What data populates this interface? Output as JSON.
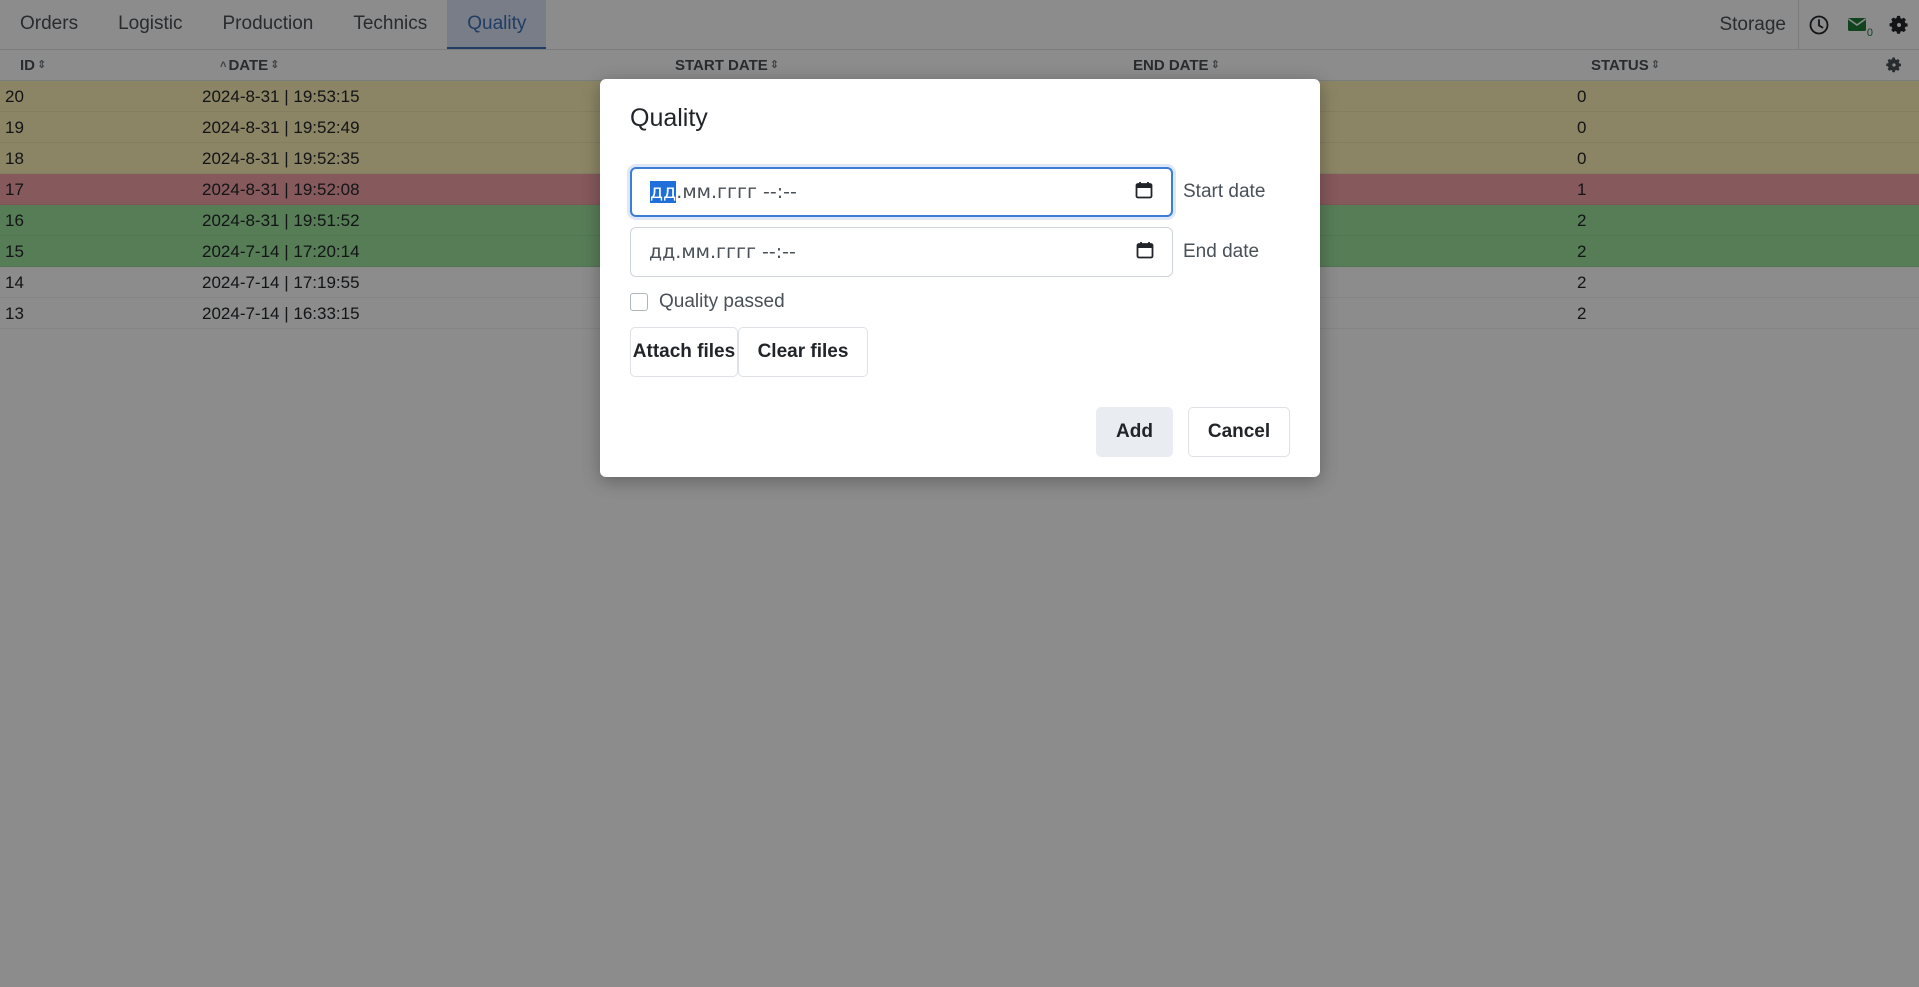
{
  "nav": {
    "tabs": [
      "Orders",
      "Logistic",
      "Production",
      "Technics",
      "Quality"
    ],
    "active_tab": "Quality",
    "storage_label": "Storage",
    "mail_count": "0",
    "icons": [
      "clock-icon",
      "mail-icon",
      "gear-icon"
    ],
    "accent_color": "#3b6fb6"
  },
  "table": {
    "headers": {
      "id": "ID",
      "date": "DATE",
      "start_date": "START DATE",
      "end_date": "END DATE",
      "status": "STATUS"
    },
    "rows": [
      {
        "id": "20",
        "date": "2024-8-31 | 19:53:15",
        "status": "0",
        "color": "yellow"
      },
      {
        "id": "19",
        "date": "2024-8-31 | 19:52:49",
        "status": "0",
        "color": "yellow"
      },
      {
        "id": "18",
        "date": "2024-8-31 | 19:52:35",
        "status": "0",
        "color": "yellow"
      },
      {
        "id": "17",
        "date": "2024-8-31 | 19:52:08",
        "status": "1",
        "color": "red"
      },
      {
        "id": "16",
        "date": "2024-8-31 | 19:51:52",
        "status": "2",
        "color": "green"
      },
      {
        "id": "15",
        "date": "2024-7-14 | 17:20:14",
        "status": "2",
        "color": "green"
      },
      {
        "id": "14",
        "date": "2024-7-14 | 17:19:55",
        "status": "2",
        "color": "plain"
      },
      {
        "id": "13",
        "date": "2024-7-14 | 16:33:15",
        "status": "2",
        "color": "plain"
      }
    ],
    "row_colors": {
      "yellow": "#fff3b8",
      "red": "#f5a3a8",
      "green": "#9ee39e",
      "plain": "#ffffff"
    }
  },
  "modal": {
    "title": "Quality",
    "start_date": {
      "selected_part": "дд",
      "rest": ".мм.гггг --:--",
      "label": "Start date"
    },
    "end_date": {
      "placeholder": "дд.мм.гггг --:--",
      "label": "End date"
    },
    "checkbox_label": "Quality passed",
    "checkbox_checked": false,
    "attach_label": "Attach files",
    "clear_label": "Clear files",
    "add_label": "Add",
    "cancel_label": "Cancel"
  }
}
